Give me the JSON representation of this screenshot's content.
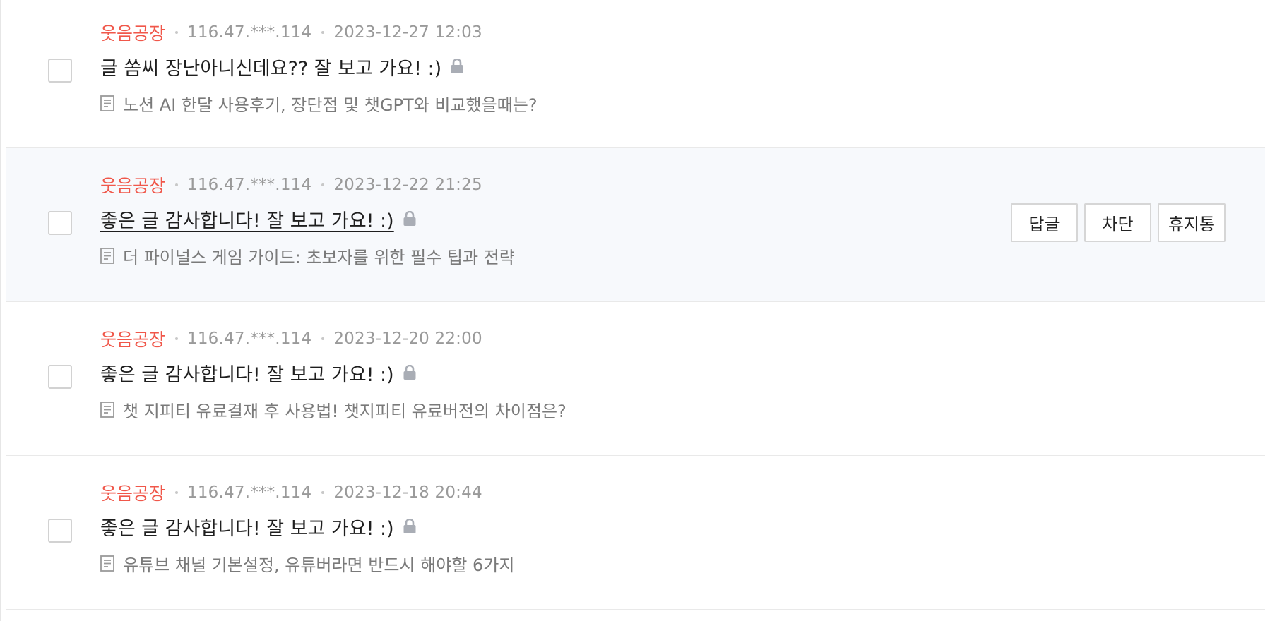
{
  "comments": [
    {
      "author": "웃음공장",
      "ip": "116.47.***.114",
      "date": "2023-12-27 12:03",
      "text": "글 쏨씨 장난아니신데요?? 잘 보고 가요! :)",
      "post_title": "노션 AI 한달 사용후기, 장단점 및 챗GPT와 비교했을때는?",
      "hovered": false
    },
    {
      "author": "웃음공장",
      "ip": "116.47.***.114",
      "date": "2023-12-22 21:25",
      "text": "좋은 글 감사합니다! 잘 보고 가요! :)",
      "post_title": "더 파이널스 게임 가이드: 초보자를 위한 필수 팁과 전략",
      "hovered": true
    },
    {
      "author": "웃음공장",
      "ip": "116.47.***.114",
      "date": "2023-12-20 22:00",
      "text": "좋은 글 감사합니다! 잘 보고 가요! :)",
      "post_title": "챗 지피티 유료결재 후 사용법! 챗지피티 유료버전의 차이점은?",
      "hovered": false
    },
    {
      "author": "웃음공장",
      "ip": "116.47.***.114",
      "date": "2023-12-18 20:44",
      "text": "좋은 글 감사합니다! 잘 보고 가요! :)",
      "post_title": "유튜브 채널 기본설정, 유튜버라면 반드시 해야할 6가지",
      "hovered": false
    }
  ],
  "actions": {
    "reply_label": "답글",
    "block_label": "차단",
    "trash_label": "휴지통"
  },
  "icons": {
    "lock": "lock-icon",
    "document": "document-icon"
  },
  "colors": {
    "author": "#f0574a",
    "meta": "#9a9a9a",
    "hover_row_bg": "#f7f9fc"
  }
}
